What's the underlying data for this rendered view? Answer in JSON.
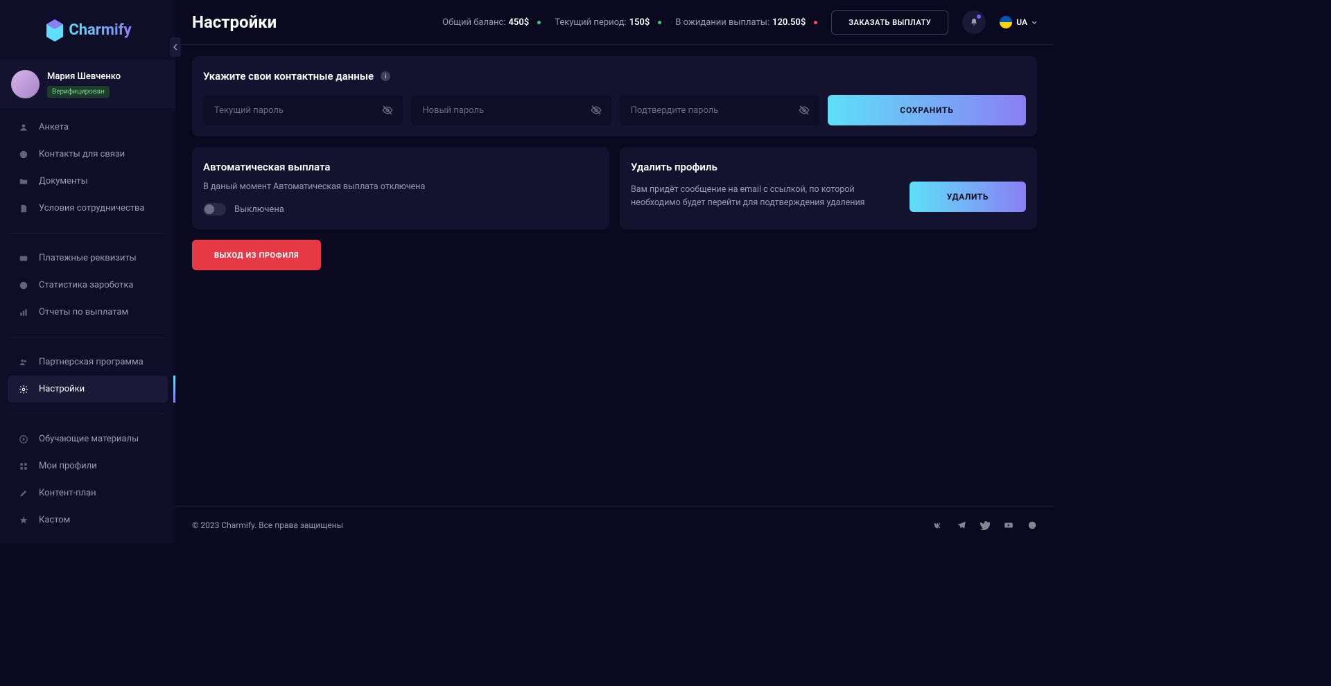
{
  "brand": "Charmify",
  "user": {
    "name": "Мария Шевченко",
    "status": "Верифицирован"
  },
  "sidebar": {
    "items": [
      {
        "label": "Анкета",
        "icon": "user-icon"
      },
      {
        "label": "Контакты для связи",
        "icon": "chat-icon"
      },
      {
        "label": "Документы",
        "icon": "folder-icon"
      },
      {
        "label": "Условия сотрудничества",
        "icon": "file-icon"
      }
    ],
    "items2": [
      {
        "label": "Платежные реквизиты",
        "icon": "card-icon"
      },
      {
        "label": "Статистика зароботка",
        "icon": "piechart-icon"
      },
      {
        "label": "Отчеты по выплатам",
        "icon": "barchart-icon"
      }
    ],
    "items3": [
      {
        "label": "Партнерская программа",
        "icon": "users-icon"
      },
      {
        "label": "Настройки",
        "icon": "gear-icon",
        "active": true
      }
    ],
    "items4": [
      {
        "label": "Обучающие материалы",
        "icon": "play-icon"
      },
      {
        "label": "Мои профили",
        "icon": "grid-icon"
      },
      {
        "label": "Контент-план",
        "icon": "pencil-icon"
      },
      {
        "label": "Кастом",
        "icon": "star-icon"
      }
    ]
  },
  "header": {
    "title": "Настройки",
    "balance_total_label": "Общий баланс:",
    "balance_total_value": "450$",
    "balance_period_label": "Текущий период:",
    "balance_period_value": "150$",
    "balance_pending_label": "В ожидании выплаты:",
    "balance_pending_value": "120.50$",
    "payout_button": "ЗАКАЗАТЬ ВЫПЛАТУ",
    "lang": "UA"
  },
  "password_section": {
    "title": "Укажите свои контактные данные",
    "current_placeholder": "Текущий пароль",
    "new_placeholder": "Новый пароль",
    "confirm_placeholder": "Подтвердите пароль",
    "save_button": "СОХРАНИТЬ"
  },
  "autopay": {
    "title": "Автоматическая выплата",
    "desc": "В даный момент Автоматическая выплата отключена",
    "toggle_label": "Выключена"
  },
  "delete_profile": {
    "title": "Удалить профиль",
    "desc": "Вам придёт сообщение на email с ссылкой, по которой необходимо будет перейти для подтверждения удаления",
    "button": "УДАЛИТЬ"
  },
  "logout_button": "ВЫХОД ИЗ ПРОФИЛЯ",
  "footer": {
    "copyright": "© 2023 Charmify. Все права защищены"
  }
}
